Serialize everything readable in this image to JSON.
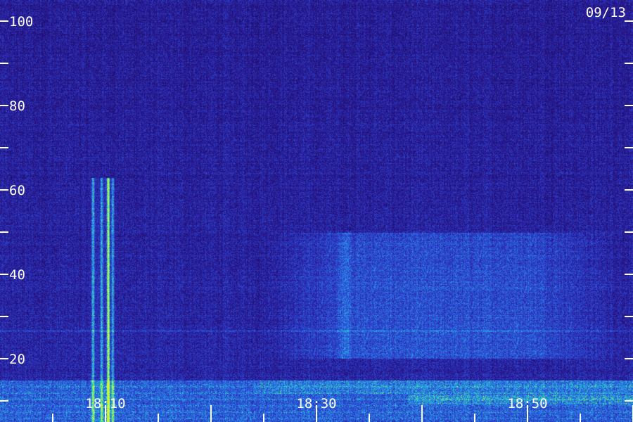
{
  "chart_data": {
    "type": "heatmap",
    "title": "",
    "date_label": "09/13",
    "xlabel": "",
    "ylabel": "",
    "ylim": [
      0,
      100
    ],
    "y_ticks_labeled": [
      100,
      80,
      60,
      40,
      20
    ],
    "y_ticks_all": [
      100,
      90,
      80,
      70,
      60,
      50,
      40,
      30,
      20,
      10
    ],
    "x_ticks_labeled": [
      {
        "value": "18:10",
        "minute": 10
      },
      {
        "value": "18:30",
        "minute": 30
      },
      {
        "value": "18:50",
        "minute": 50
      }
    ],
    "x_range_minutes": [
      5,
      65
    ],
    "x_minor_step_minutes": 5,
    "colors": {
      "background": "#1c0f55",
      "low": "#2a1a8c",
      "mid": "#2f6fe0",
      "high": "#39e6a0",
      "peak": "#c8f040"
    },
    "features": [
      {
        "name": "vertical bursts",
        "minute_range": [
          8.8,
          10.6
        ],
        "y_range": [
          0,
          63
        ]
      },
      {
        "name": "diffuse band",
        "minute_range": [
          25,
          59
        ],
        "y_range": [
          20,
          50
        ]
      },
      {
        "name": "low-frequency band",
        "minute_range": [
          5,
          65
        ],
        "y_range": [
          4,
          15
        ]
      }
    ]
  }
}
